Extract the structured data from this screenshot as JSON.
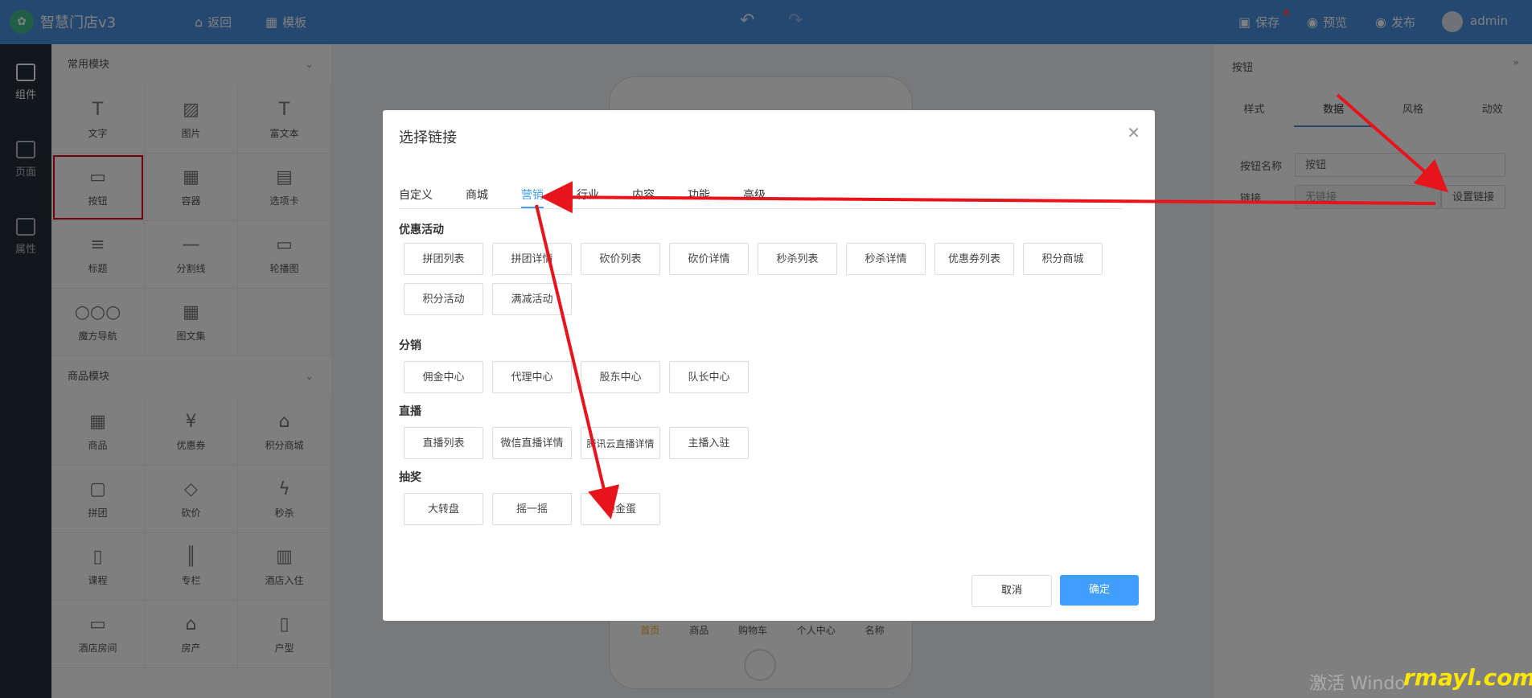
{
  "app": {
    "title": "智慧门店v3"
  },
  "topbar": {
    "back": "返回",
    "template": "模板",
    "save": "保存",
    "preview": "预览",
    "publish": "发布",
    "user": "admin"
  },
  "rail": {
    "components": "组件",
    "pages": "页面",
    "attributes": "属性"
  },
  "panel": {
    "common_title": "常用模块",
    "common_items": [
      "文字",
      "图片",
      "富文本",
      "按钮",
      "容器",
      "选项卡",
      "标题",
      "分割线",
      "轮播图",
      "魔方导航",
      "图文集"
    ],
    "goods_title": "商品模块",
    "goods_items": [
      "商品",
      "优惠券",
      "积分商城",
      "拼团",
      "砍价",
      "秒杀",
      "课程",
      "专栏",
      "酒店入住",
      "酒店房间",
      "房产",
      "户型"
    ]
  },
  "phone": {
    "tabs": [
      "首页",
      "商品",
      "购物车",
      "个人中心",
      "名称"
    ]
  },
  "right": {
    "title": "按钮",
    "tabs": [
      "样式",
      "数据",
      "风格",
      "动效"
    ],
    "active_tab": "数据",
    "name_label": "按钮名称",
    "name_value": "按钮",
    "link_label": "链接",
    "link_placeholder": "无链接",
    "set_link": "设置链接"
  },
  "dialog": {
    "title": "选择链接",
    "tabs": [
      "自定义",
      "商城",
      "营销",
      "行业",
      "内容",
      "功能",
      "高级"
    ],
    "active_tab": "营销",
    "sections": [
      {
        "title": "优惠活动",
        "items": [
          "拼团列表",
          "拼团详情",
          "砍价列表",
          "砍价详情",
          "秒杀列表",
          "秒杀详情",
          "优惠券列表",
          "积分商城",
          "积分活动",
          "满减活动"
        ]
      },
      {
        "title": "分销",
        "items": [
          "佣金中心",
          "代理中心",
          "股东中心",
          "队长中心"
        ]
      },
      {
        "title": "直播",
        "items": [
          "直播列表",
          "微信直播详情",
          "腾讯云直播详情",
          "主播入驻"
        ]
      },
      {
        "title": "抽奖",
        "items": [
          "大转盘",
          "摇一摇",
          "砸金蛋"
        ]
      }
    ],
    "cancel": "取消",
    "confirm": "确定"
  },
  "watermark": "激活 Windo",
  "watermark_brand": "rmayl.com"
}
